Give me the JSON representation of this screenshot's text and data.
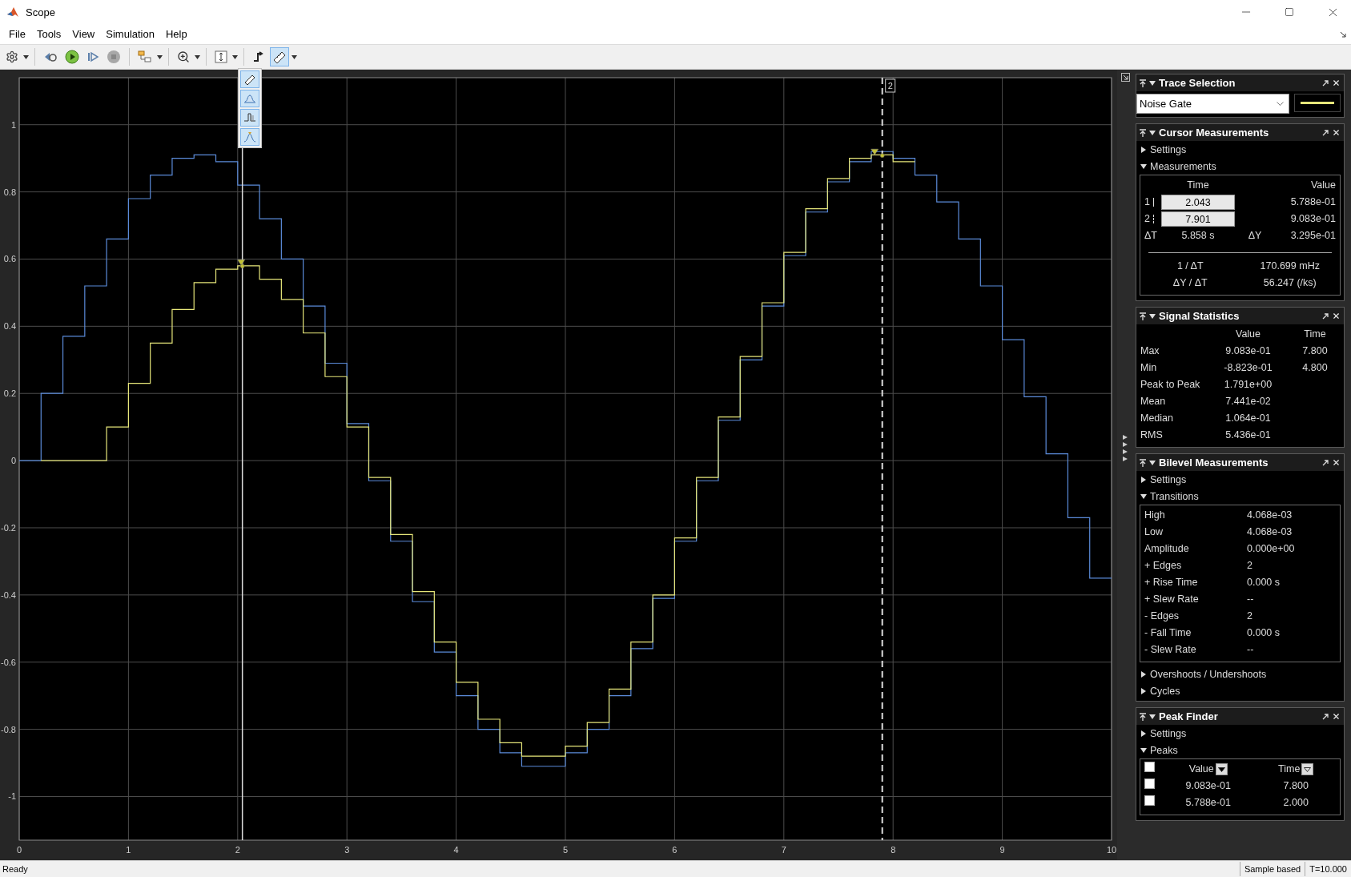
{
  "window": {
    "title": "Scope"
  },
  "menu": [
    {
      "label": "File"
    },
    {
      "label": "Tools"
    },
    {
      "label": "View"
    },
    {
      "label": "Simulation"
    },
    {
      "label": "Help"
    }
  ],
  "toolbar": {
    "measurements_selected": true,
    "measurements_menu_open": true
  },
  "plot": {
    "cursor_tag": "2",
    "chart_data": {
      "type": "line",
      "grid": true,
      "xlim": [
        0,
        10
      ],
      "ylim": [
        -1.13,
        1.14
      ],
      "ref_lines": [
        {
          "axis": "x",
          "value": 2.043
        },
        {
          "axis": "x",
          "value": 7.901
        }
      ],
      "xticks": [
        0,
        1,
        2,
        3,
        4,
        5,
        6,
        7,
        8,
        9,
        10
      ],
      "yticks": [
        {
          "value": 1,
          "label": "1"
        },
        {
          "value": 0.8,
          "label": "0.8"
        },
        {
          "value": 0.6,
          "label": "0.6"
        },
        {
          "value": 0.4,
          "label": "0.4"
        },
        {
          "value": 0.2,
          "label": "0.2"
        },
        {
          "value": 0,
          "label": "0"
        },
        {
          "value": -0.2,
          "label": "-0.2"
        },
        {
          "value": -0.4,
          "label": "-0.4"
        },
        {
          "value": -0.6,
          "label": "-0.6"
        },
        {
          "value": -0.8,
          "label": "-0.8"
        },
        {
          "value": -1,
          "label": "-1"
        }
      ],
      "x": [
        0,
        0.2,
        0.2,
        0.4,
        0.4,
        0.6,
        0.6,
        0.8,
        0.8,
        1,
        1,
        1.2,
        1.2,
        1.4,
        1.4,
        1.6,
        1.6,
        1.8,
        1.8,
        2,
        2,
        2.2,
        2.2,
        2.4,
        2.4,
        2.6,
        2.6,
        2.8,
        2.8,
        3,
        3,
        3.2,
        3.2,
        3.4,
        3.4,
        3.6,
        3.6,
        3.8,
        3.8,
        4,
        4,
        4.2,
        4.2,
        4.4,
        4.4,
        4.6,
        4.6,
        4.8,
        4.8,
        5,
        5,
        5.2,
        5.2,
        5.4,
        5.4,
        5.6,
        5.6,
        5.8,
        5.8,
        6,
        6,
        6.2,
        6.2,
        6.4,
        6.4,
        6.6,
        6.6,
        6.8,
        6.8,
        7,
        7,
        7.2,
        7.2,
        7.4,
        7.4,
        7.6,
        7.6,
        7.8,
        7.8,
        8,
        8,
        8.2,
        8.2,
        8.4,
        8.4,
        8.6,
        8.6,
        8.8,
        8.8,
        9,
        9,
        9.2,
        9.2,
        9.4,
        9.4,
        9.6,
        9.6,
        9.8,
        9.8,
        10
      ],
      "series": [
        {
          "color": "#5b8bd9",
          "values": [
            0,
            0,
            0.2,
            0.2,
            0.37,
            0.37,
            0.52,
            0.52,
            0.66,
            0.66,
            0.78,
            0.78,
            0.85,
            0.85,
            0.9,
            0.9,
            0.91,
            0.91,
            0.89,
            0.89,
            0.82,
            0.82,
            0.72,
            0.72,
            0.6,
            0.6,
            0.46,
            0.46,
            0.29,
            0.29,
            0.11,
            0.11,
            -0.06,
            -0.06,
            -0.24,
            -0.24,
            -0.42,
            -0.42,
            -0.57,
            -0.57,
            -0.7,
            -0.7,
            -0.8,
            -0.8,
            -0.87,
            -0.87,
            -0.91,
            -0.91,
            -0.91,
            -0.91,
            -0.87,
            -0.87,
            -0.8,
            -0.8,
            -0.7,
            -0.7,
            -0.56,
            -0.56,
            -0.41,
            -0.41,
            -0.24,
            -0.24,
            -0.06,
            -0.06,
            0.12,
            0.12,
            0.3,
            0.3,
            0.46,
            0.46,
            0.61,
            0.61,
            0.74,
            0.74,
            0.83,
            0.83,
            0.89,
            0.89,
            0.92,
            0.92,
            0.9,
            0.9,
            0.85,
            0.85,
            0.77,
            0.77,
            0.66,
            0.66,
            0.52,
            0.52,
            0.36,
            0.36,
            0.19,
            0.19,
            0.02,
            0.02,
            -0.17,
            -0.17,
            -0.35,
            -0.35
          ]
        },
        {
          "color": "#e6e67a",
          "values": [
            null,
            null,
            0,
            0,
            0,
            0,
            0,
            0,
            0.1,
            0.1,
            0.23,
            0.23,
            0.35,
            0.35,
            0.45,
            0.45,
            0.53,
            0.53,
            0.57,
            0.57,
            0.58,
            0.58,
            0.54,
            0.54,
            0.48,
            0.48,
            0.38,
            0.38,
            0.25,
            0.25,
            0.1,
            0.1,
            -0.05,
            -0.05,
            -0.22,
            -0.22,
            -0.39,
            -0.39,
            -0.54,
            -0.54,
            -0.66,
            -0.66,
            -0.77,
            -0.77,
            -0.84,
            -0.84,
            -0.88,
            -0.88,
            -0.88,
            -0.88,
            -0.85,
            -0.85,
            -0.78,
            -0.78,
            -0.68,
            -0.68,
            -0.54,
            -0.54,
            -0.4,
            -0.4,
            -0.23,
            -0.23,
            -0.05,
            -0.05,
            0.13,
            0.13,
            0.31,
            0.31,
            0.47,
            0.47,
            0.62,
            0.62,
            0.75,
            0.75,
            0.84,
            0.84,
            0.9,
            0.9,
            0.91,
            0.91,
            0.89,
            0.89,
            null,
            null,
            null,
            null,
            null,
            null,
            null,
            null,
            null,
            null,
            null,
            null,
            null,
            null,
            null,
            null,
            null,
            null
          ]
        }
      ]
    }
  },
  "panels": [
    {
      "kind": "trace",
      "title": "Trace Selection",
      "value": "Noise Gate"
    },
    {
      "kind": "cursor",
      "title": "Cursor Measurements",
      "sections": [
        {
          "label": "Settings",
          "expanded": false
        },
        {
          "label": "Measurements",
          "expanded": true,
          "kind": "cursor_table",
          "headers": [
            "Time",
            "Value"
          ],
          "cursors": [
            {
              "label": "1",
              "time": "2.043",
              "value": "5.788e-01"
            },
            {
              "label": "2",
              "time": "7.901",
              "value": "9.083e-01"
            }
          ],
          "deltas": [
            {
              "label": "ΔT",
              "value": "5.858 s"
            },
            {
              "label": "ΔY",
              "value": "3.295e-01"
            }
          ],
          "ratios": [
            {
              "label": "1 / ΔT",
              "value": "170.699 mHz"
            },
            {
              "label": "ΔY / ΔT",
              "value": "56.247 (/ks)"
            }
          ]
        }
      ]
    },
    {
      "kind": "stats",
      "title": "Signal Statistics",
      "headers": [
        "Value",
        "Time"
      ],
      "rows": [
        {
          "label": "Max",
          "value": "9.083e-01",
          "time": "7.800"
        },
        {
          "label": "Min",
          "value": "-8.823e-01",
          "time": "4.800"
        },
        {
          "label": "Peak to Peak",
          "value": "1.791e+00"
        },
        {
          "label": "Mean",
          "value": "7.441e-02"
        },
        {
          "label": "Median",
          "value": "1.064e-01"
        },
        {
          "label": "RMS",
          "value": "5.436e-01"
        }
      ]
    },
    {
      "kind": "bilevel",
      "title": "Bilevel Measurements",
      "sections": [
        {
          "label": "Settings",
          "expanded": false
        },
        {
          "label": "Transitions",
          "expanded": true,
          "kind": "list",
          "rows": [
            {
              "label": "High",
              "value": "4.068e-03"
            },
            {
              "label": "Low",
              "value": "4.068e-03"
            },
            {
              "label": "Amplitude",
              "value": "0.000e+00"
            },
            {
              "label": "+ Edges",
              "value": "2"
            },
            {
              "label": "+ Rise Time",
              "value": "0.000 s"
            },
            {
              "label": "+ Slew Rate",
              "value": "--"
            },
            {
              "label": "- Edges",
              "value": "2"
            },
            {
              "label": "- Fall Time",
              "value": "0.000 s"
            },
            {
              "label": "- Slew Rate",
              "value": "--"
            }
          ]
        },
        {
          "label": "Overshoots / Undershoots",
          "expanded": false
        },
        {
          "label": "Cycles",
          "expanded": false
        }
      ]
    },
    {
      "kind": "peaks",
      "title": "Peak Finder",
      "sections": [
        {
          "label": "Settings",
          "expanded": false
        },
        {
          "label": "Peaks",
          "expanded": true,
          "kind": "peaks",
          "all_checked": false,
          "headers": [
            {
              "label": "Value",
              "sorted": true
            },
            {
              "label": "Time",
              "sorted": false
            }
          ],
          "rows": [
            {
              "value": "9.083e-01",
              "time": "7.800",
              "checked": false
            },
            {
              "value": "5.788e-01",
              "time": "2.000",
              "checked": false
            }
          ]
        }
      ]
    }
  ],
  "status_bar": {
    "status": "Ready",
    "mode": "Sample based",
    "time": "T=10.000"
  }
}
